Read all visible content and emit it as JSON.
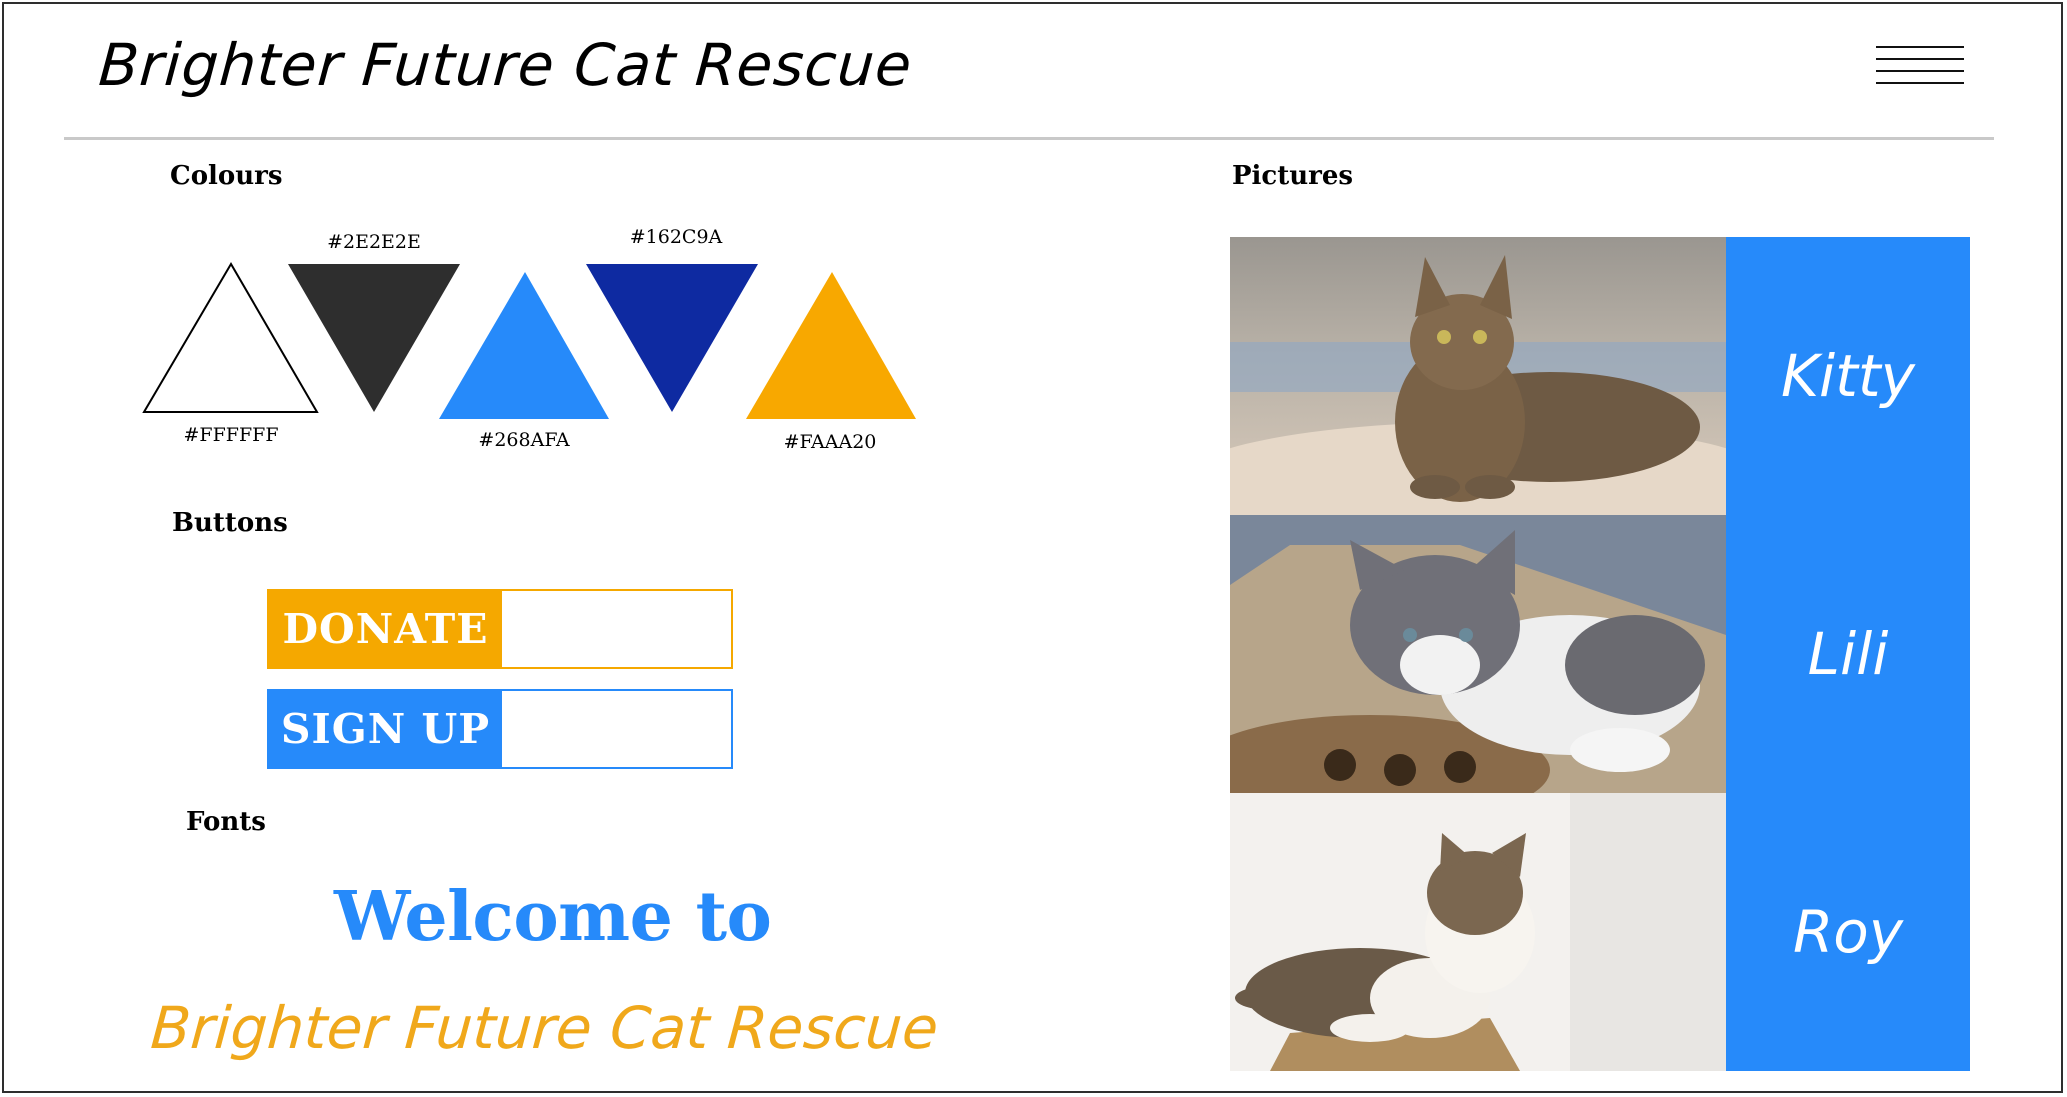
{
  "header": {
    "site_title": "Brighter Future Cat Rescue",
    "menu_icon": "hamburger-menu-icon"
  },
  "sections": {
    "colours": "Colours",
    "buttons": "Buttons",
    "fonts": "Fonts",
    "pictures": "Pictures"
  },
  "colours": [
    {
      "label": "#FFFFFF",
      "hex": "#FFFFFF"
    },
    {
      "label": "#2E2E2E",
      "hex": "#2E2E2E"
    },
    {
      "label": "#268AFA",
      "hex": "#268AFA"
    },
    {
      "label": "#162C9A",
      "hex": "#162C9A"
    },
    {
      "label": "#FAAA20",
      "hex": "#FAAA20"
    }
  ],
  "buttons": {
    "donate": "DONATE",
    "sign_up": "SIGN UP"
  },
  "fonts": {
    "welcome": "Welcome to",
    "brand": "Brighter Future Cat Rescue"
  },
  "pictures": [
    {
      "name": "Kitty"
    },
    {
      "name": "Lili"
    },
    {
      "name": "Roy"
    }
  ],
  "accent_colors": {
    "blue": "#268AFA",
    "orange": "#FAAA20",
    "dark": "#2E2E2E",
    "navy": "#162C9A"
  }
}
